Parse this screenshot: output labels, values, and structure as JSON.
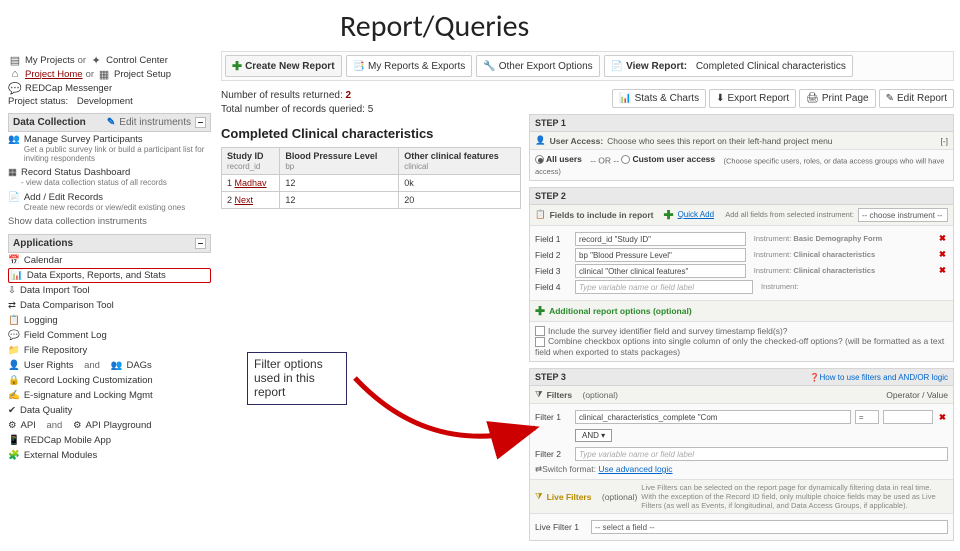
{
  "title": "Report/Queries",
  "nav": {
    "my_projects": "My Projects",
    "control_center": "Control Center",
    "project_home": "Project Home",
    "project_setup": "Project Setup",
    "messenger": "REDCap Messenger",
    "status_label": "Project status:",
    "status_value": "Development",
    "edit_instruments": "Edit instruments",
    "or": "or"
  },
  "sections": {
    "data_collection": "Data Collection",
    "applications": "Applications"
  },
  "sidebar": {
    "survey_participants": {
      "title": "Manage Survey Participants",
      "sub": "Get a public survey link or build a participant list for inviting respondents"
    },
    "record_dashboard": {
      "title": "Record Status Dashboard",
      "sub": "- view data collection status of all records"
    },
    "add_edit": {
      "title": "Add / Edit Records",
      "sub": "Create new records or view/edit existing ones"
    },
    "show_dc": "Show data collection instruments",
    "apps": [
      "Calendar",
      "Data Exports, Reports, and Stats",
      "Data Import Tool",
      "Data Comparison Tool",
      "Logging",
      "Field Comment Log",
      "File Repository",
      "E-signature and Locking Mgmt",
      "Data Quality",
      "REDCap Mobile App",
      "External Modules"
    ],
    "user_rights_a": "User Rights",
    "user_rights_b": "DAGs",
    "and": "and",
    "rec_lock": "Record Locking Customization",
    "api_a": "API",
    "api_b": "API Playground"
  },
  "toolbar": {
    "create": "Create New Report",
    "my_reports": "My Reports & Exports",
    "other": "Other Export Options",
    "view_report": "View Report:",
    "view_report_name": "Completed Clinical characteristics"
  },
  "stats": {
    "label1": "Number of results returned:",
    "val1": "2",
    "label2": "Total number of records queried:",
    "val2": "5"
  },
  "actions": {
    "stats": "Stats & Charts",
    "export": "Export Report",
    "print": "Print Page",
    "edit": "Edit Report"
  },
  "report_title": "Completed Clinical characteristics",
  "table": {
    "headers": [
      "Study ID",
      "Blood Pressure Level",
      "Other clinical features"
    ],
    "subheaders": [
      "record_id",
      "bp",
      "clinical"
    ],
    "rows": [
      [
        "1",
        "Madhav",
        "12",
        "0k"
      ],
      [
        "2",
        "Next",
        "12",
        "20"
      ]
    ]
  },
  "step1": {
    "hd": "STEP 1",
    "sub": "User Access:",
    "sub2": "Choose who sees this report on their left-hand project menu",
    "all": "All users",
    "or": "-- OR --",
    "custom": "Custom user access",
    "hint": "(Choose specific users, roles, or data access groups who will have access)"
  },
  "step2": {
    "hd": "STEP 2",
    "sub": "Fields to include in report",
    "quick": "Quick Add",
    "tip": "Add all fields from selected instrument:",
    "sel": "-- choose instrument --",
    "fields": [
      {
        "lbl": "Field 1",
        "val": "record_id \"Study ID\"",
        "inst": "Basic Demography Form"
      },
      {
        "lbl": "Field 2",
        "val": "bp \"Blood Pressure Level\"",
        "inst": "Clinical characteristics"
      },
      {
        "lbl": "Field 3",
        "val": "clinical \"Other clinical features\"",
        "inst": "Clinical characteristics"
      },
      {
        "lbl": "Field 4",
        "val": "",
        "ph": "Type variable name or field label",
        "inst": ""
      }
    ],
    "inst_pre": "Instrument:"
  },
  "addl": {
    "title": "Additional report options (optional)",
    "opt1": "Include the survey identifier field and survey timestamp field(s)?",
    "opt2": "Combine checkbox options into single column of only the checked-off options? (will be formatted as a text field when exported to stats packages)"
  },
  "step3": {
    "hd": "STEP 3",
    "help": "How to use filters and AND/OR logic",
    "filters": "Filters",
    "opt": "(optional)",
    "opval": "Operator / Value",
    "f1": "Filter 1",
    "f1v": "clinical_characteristics_complete \"Com",
    "f2": "Filter 2",
    "f2ph": "Type variable name or field label",
    "and": "AND",
    "switch": "Switch format:",
    "adv": "Use advanced logic",
    "live": "Live Filters",
    "live_note": "Live Filters can be selected on the report page for dynamically filtering data in real time. With the exception of the Record ID field, only multiple choice fields may be used as Live Filters (as well as Events, if longitudinal, and Data Access Groups, if applicable).",
    "lf1": "Live Filter 1",
    "lf1v": "-- select a field --"
  },
  "callout": "Filter options used in this report"
}
